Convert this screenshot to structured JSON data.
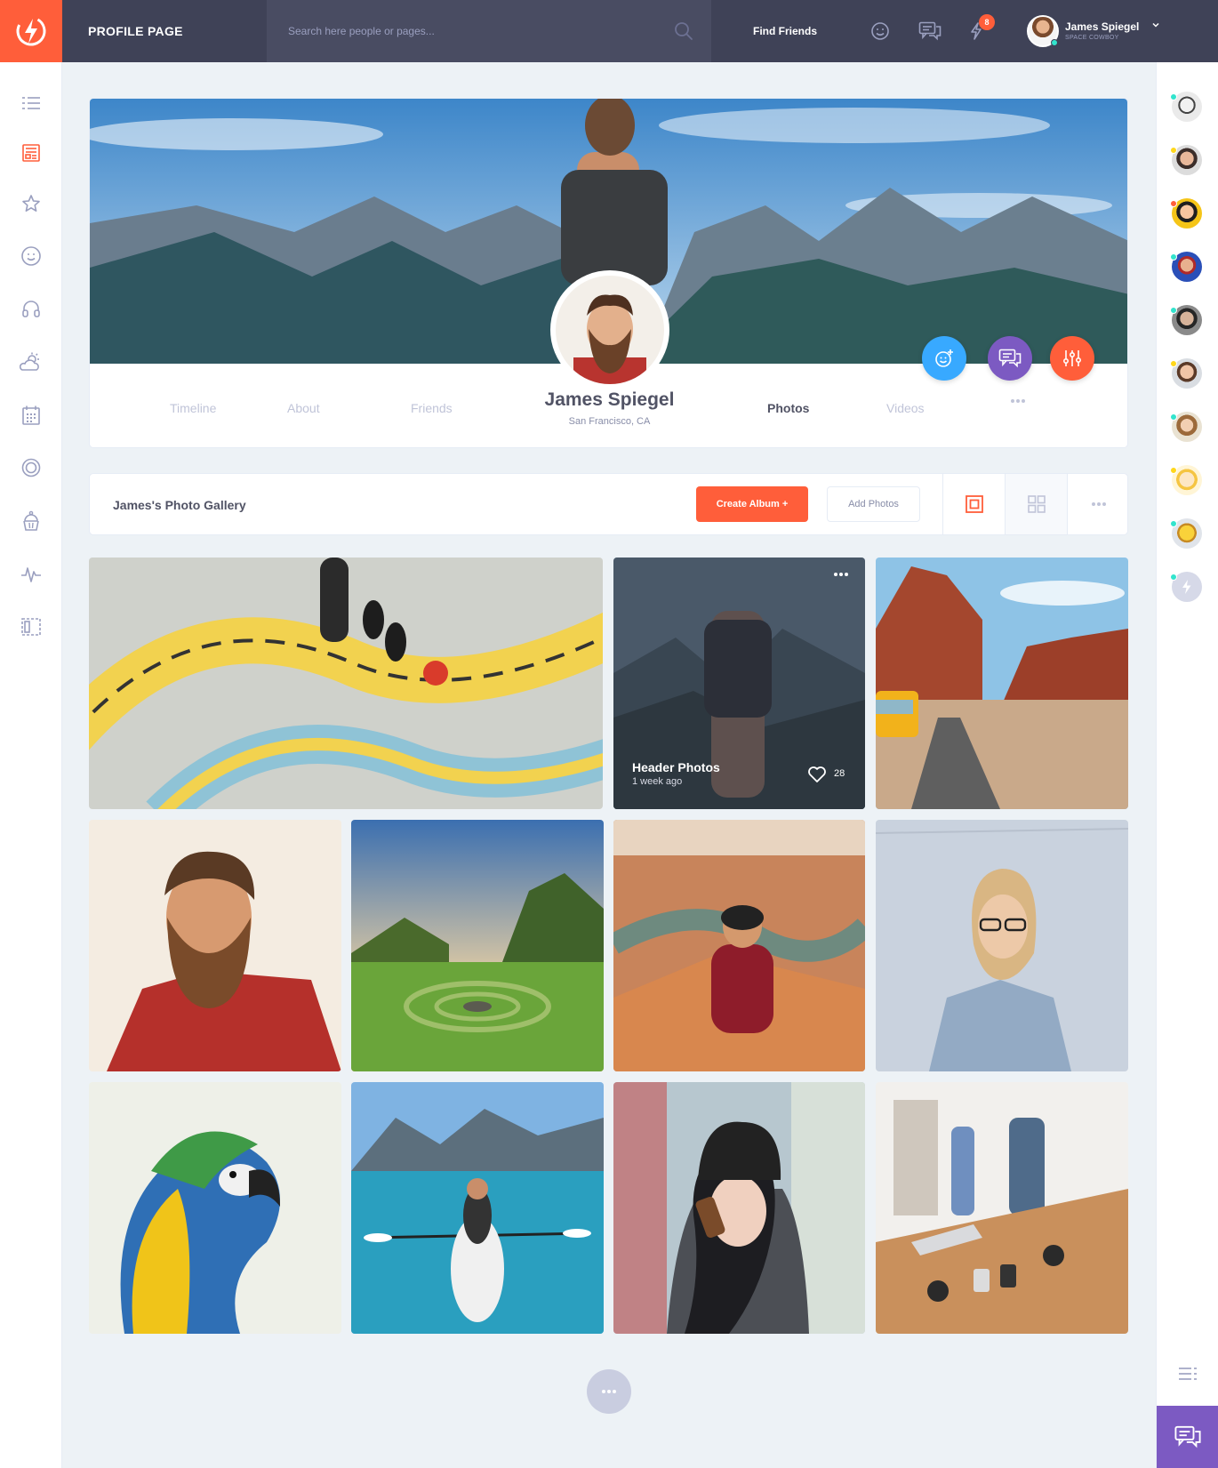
{
  "header": {
    "page_title": "PROFILE PAGE",
    "search_placeholder": "Search here people or pages...",
    "find_friends": "Find Friends",
    "notification_count": "8",
    "user_name": "James Spiegel",
    "user_status": "SPACE COWBOY"
  },
  "left_sidebar": {
    "icons": [
      "menu-icon",
      "newsfeed-icon",
      "star-icon",
      "happy-face-icon",
      "headphones-icon",
      "weather-icon",
      "calendar-icon",
      "badge-icon",
      "cupcake-icon",
      "stats-icon",
      "manage-widgets-icon"
    ],
    "active": "newsfeed-icon"
  },
  "profile": {
    "name": "James Spiegel",
    "location": "San Francisco, CA",
    "tabs_left": [
      "Timeline",
      "About",
      "Friends"
    ],
    "tabs_right": [
      "Photos",
      "Videos"
    ],
    "active_tab": "Photos",
    "action_colors": [
      "#38a9ff",
      "#7c5ac2",
      "#ff5e3a"
    ]
  },
  "gallery": {
    "title": "James's Photo Gallery",
    "create_album": "Create Album  +",
    "add_photos": "Add Photos",
    "view_modes": [
      "album-view-icon",
      "grid-view-icon",
      "more-options-icon"
    ],
    "photos": [
      {
        "name": "octopus-street-art"
      },
      {
        "name": "header-photos-album",
        "title": "Header Photos",
        "time": "1 week ago",
        "likes": "28"
      },
      {
        "name": "desert-road-van"
      },
      {
        "name": "bearded-man-portrait"
      },
      {
        "name": "green-valley-sunset"
      },
      {
        "name": "canyon-hiker"
      },
      {
        "name": "woman-with-glasses"
      },
      {
        "name": "macaw-parrot"
      },
      {
        "name": "kayak-lake"
      },
      {
        "name": "woman-on-phone"
      },
      {
        "name": "office-desk"
      }
    ]
  },
  "right_sidebar": {
    "friends_status": [
      "#32e4cd",
      "#ffd71b",
      "#ff5e3a",
      "#32e4cd",
      "#32e4cd",
      "#ffd71b",
      "#32e4cd",
      "#ffd71b",
      "#32e4cd",
      "#32e4cd"
    ]
  },
  "colors": {
    "accent": "#ff5e3a",
    "dark": "#3f4257",
    "purple": "#7c5ac2",
    "blue": "#38a9ff"
  }
}
